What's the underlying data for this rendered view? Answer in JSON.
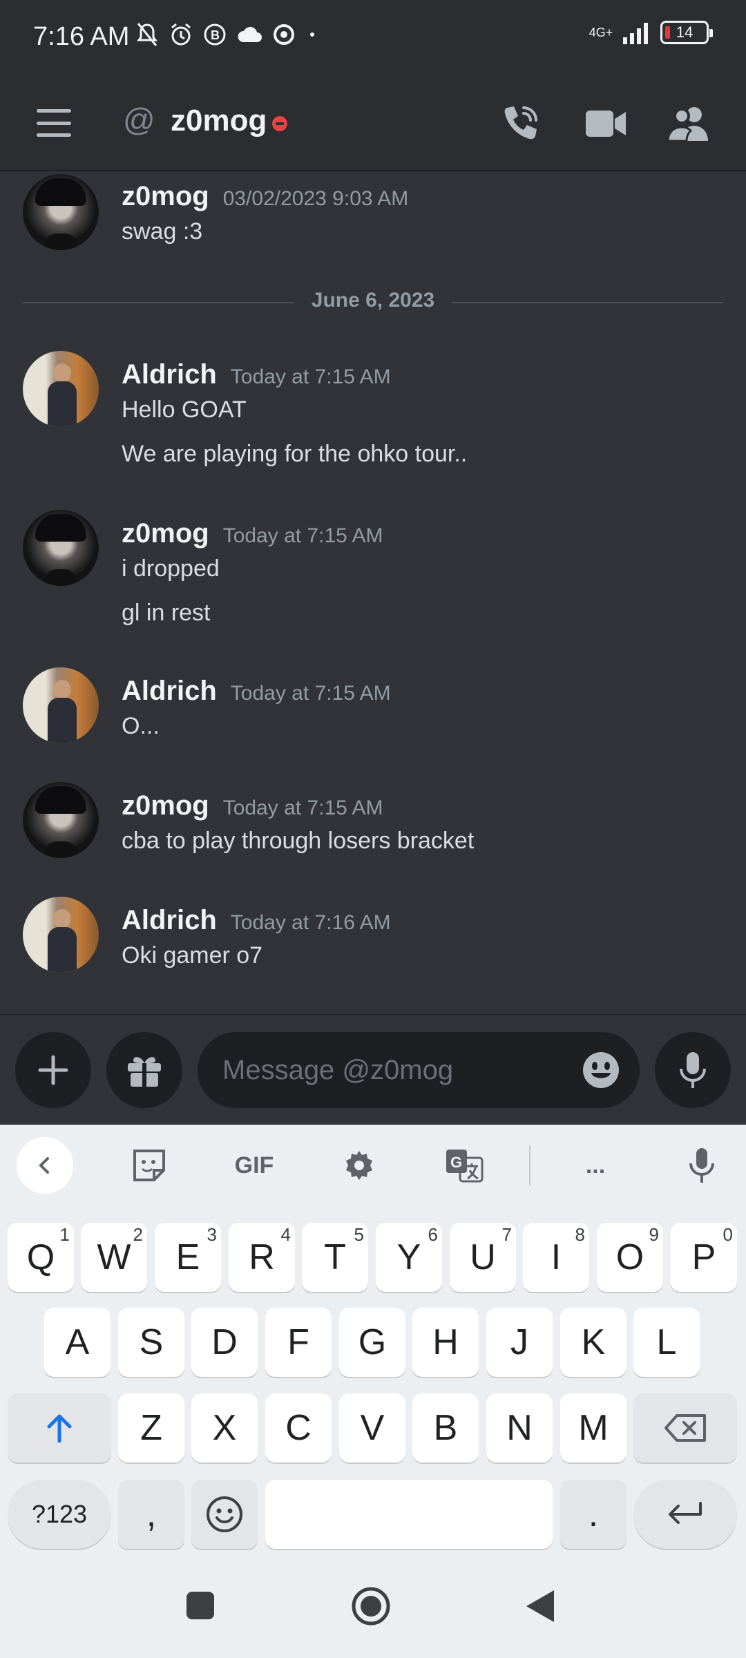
{
  "status_bar": {
    "time": "7:16 AM",
    "network": "4G+",
    "battery": "14"
  },
  "header": {
    "at_symbol": "@",
    "title": "z0mog"
  },
  "messages": [
    {
      "author": "z0mog",
      "timestamp": "03/02/2023 9:03 AM",
      "lines": [
        "swag :3"
      ]
    },
    {
      "author": "Aldrich",
      "timestamp": "Today at 7:15 AM",
      "lines": [
        "Hello GOAT",
        "We are playing for the ohko tour.."
      ]
    },
    {
      "author": "z0mog",
      "timestamp": "Today at 7:15 AM",
      "lines": [
        "i dropped",
        "gl in rest"
      ]
    },
    {
      "author": "Aldrich",
      "timestamp": "Today at 7:15 AM",
      "lines": [
        "O..."
      ]
    },
    {
      "author": "z0mog",
      "timestamp": "Today at 7:15 AM",
      "lines": [
        "cba to play through losers bracket"
      ]
    },
    {
      "author": "Aldrich",
      "timestamp": "Today at 7:16 AM",
      "lines": [
        "Oki gamer o7"
      ]
    }
  ],
  "date_divider": "June 6, 2023",
  "composer": {
    "placeholder": "Message @z0mog",
    "value": ""
  },
  "keyboard": {
    "toolbar": {
      "gif_label": "GIF",
      "more_label": "..."
    },
    "row1": [
      {
        "key": "Q",
        "hint": "1"
      },
      {
        "key": "W",
        "hint": "2"
      },
      {
        "key": "E",
        "hint": "3"
      },
      {
        "key": "R",
        "hint": "4"
      },
      {
        "key": "T",
        "hint": "5"
      },
      {
        "key": "Y",
        "hint": "6"
      },
      {
        "key": "U",
        "hint": "7"
      },
      {
        "key": "I",
        "hint": "8"
      },
      {
        "key": "O",
        "hint": "9"
      },
      {
        "key": "P",
        "hint": "0"
      }
    ],
    "row2": [
      "A",
      "S",
      "D",
      "F",
      "G",
      "H",
      "J",
      "K",
      "L"
    ],
    "row3": [
      "Z",
      "X",
      "C",
      "V",
      "B",
      "N",
      "M"
    ],
    "symbols_label": "?123",
    "comma_label": ",",
    "period_label": "."
  },
  "colors": {
    "background": "#313338",
    "header": "#2b2d31",
    "input": "#1e1f22",
    "dnd": "#f23f43",
    "shift_accent": "#1a73e8"
  }
}
